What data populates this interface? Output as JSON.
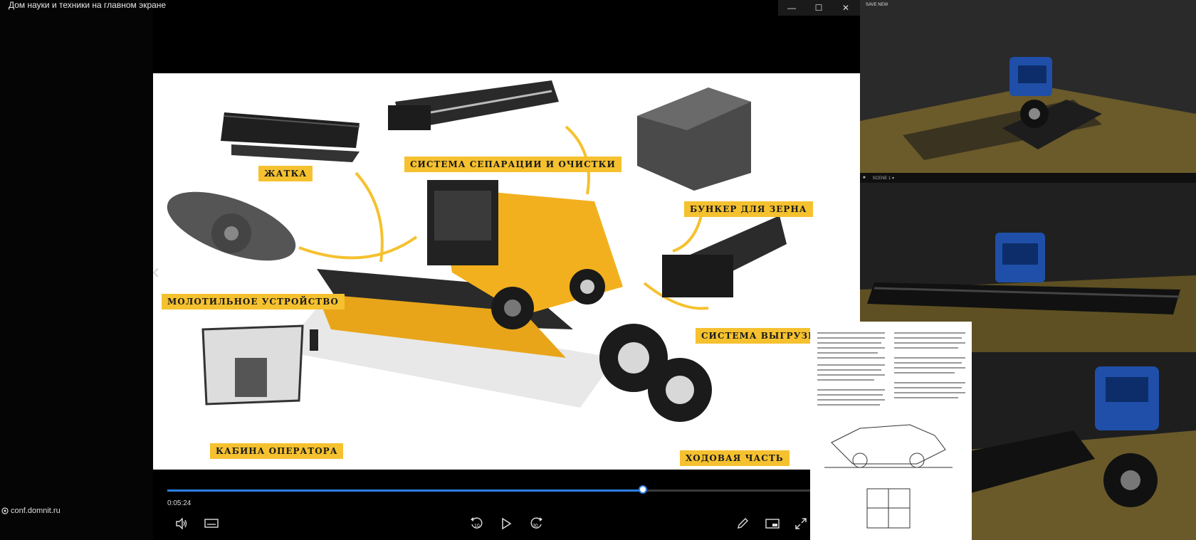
{
  "window": {
    "title": "Дом науки и техники на главном экране",
    "site": "conf.domnit.ru",
    "minimize_icon": "minimize-icon",
    "maximize_icon": "maximize-icon",
    "close_icon": "close-icon"
  },
  "slide": {
    "labels": {
      "header": "ЖАТКА",
      "separation": "СИСТЕМА СЕПАРАЦИИ И ОЧИСТКИ",
      "bunker": "БУНКЕР ДЛЯ ЗЕРНА",
      "threshing": "МОЛОТИЛЬНОЕ УСТРОЙСТВО",
      "unloading": "СИСТЕМА ВЫГРУЗКИ ЗЕ",
      "cabin": "КАБИНА ОПЕРАТОРА",
      "chassis": "ХОДОВАЯ ЧАСТЬ"
    },
    "colors": {
      "accent": "#f5c12f",
      "combine": "#f2b01e",
      "dark": "#1f1f1f"
    }
  },
  "player": {
    "current_time": "0:05:24",
    "progress": 0.74,
    "accent": "#2e7fe6",
    "controls": [
      "volume-icon",
      "subtitles-icon",
      "rewind-10-icon",
      "play-icon",
      "forward-30-icon",
      "pen-icon",
      "miniplayer-icon",
      "fullscreen-icon"
    ],
    "rewind_label": "10",
    "forward_label": "30"
  },
  "side_panel": {
    "rec_label": "SAVE NEW",
    "cam_bar_text": "SCENE 1 ▾"
  }
}
